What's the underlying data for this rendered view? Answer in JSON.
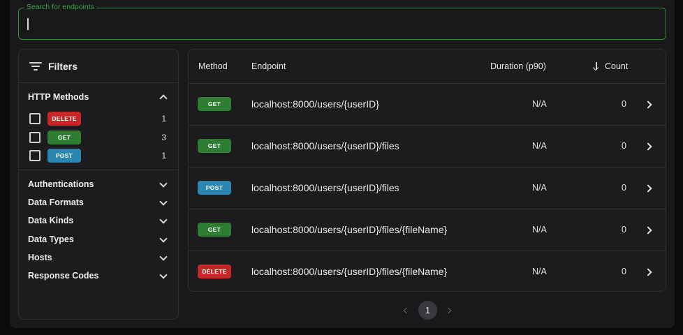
{
  "search": {
    "label": "Search for endpoints",
    "value": ""
  },
  "filters": {
    "title": "Filters",
    "http_methods": {
      "title": "HTTP Methods",
      "items": [
        {
          "label": "DELETE",
          "count": "1"
        },
        {
          "label": "GET",
          "count": "3"
        },
        {
          "label": "POST",
          "count": "1"
        }
      ]
    },
    "sections": [
      "Authentications",
      "Data Formats",
      "Data Kinds",
      "Data Types",
      "Hosts",
      "Response Codes"
    ]
  },
  "table": {
    "headers": {
      "method": "Method",
      "endpoint": "Endpoint",
      "duration": "Duration (p90)",
      "count": "Count"
    },
    "rows": [
      {
        "method": "GET",
        "endpoint": "localhost:8000/users/{userID}",
        "duration": "N/A",
        "count": "0"
      },
      {
        "method": "GET",
        "endpoint": "localhost:8000/users/{userID}/files",
        "duration": "N/A",
        "count": "0"
      },
      {
        "method": "POST",
        "endpoint": "localhost:8000/users/{userID}/files",
        "duration": "N/A",
        "count": "0"
      },
      {
        "method": "GET",
        "endpoint": "localhost:8000/users/{userID}/files/{fileName}",
        "duration": "N/A",
        "count": "0"
      },
      {
        "method": "DELETE",
        "endpoint": "localhost:8000/users/{userID}/files/{fileName}",
        "duration": "N/A",
        "count": "0"
      }
    ]
  },
  "pagination": {
    "current_page": "1"
  },
  "colors": {
    "get": "#2f7d32",
    "post": "#2c86b2",
    "delete": "#c62828",
    "accent": "#2e8f34"
  },
  "icons": {
    "filter": "filter-lines-icon",
    "sort": "arrow-down-icon",
    "row_open": "chevron-right-icon"
  }
}
